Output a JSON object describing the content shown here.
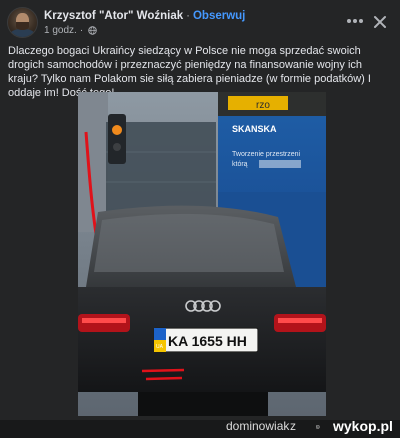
{
  "post": {
    "author": "Krzysztof \"Ator\" Woźniak",
    "separator": "·",
    "follow_label": "Obserwuj",
    "time": "1 godz.",
    "text": "Dlaczego bogaci Ukraińcy siedzący w Polsce nie moga sprzedać swoich drogich samochodów i przeznaczyć pieniędzy na finansowanie wojny ich kraju? Tylko nam Polakom sie siłą zabiera pieniadze (w formie podatków) I oddaje im! Dość tego!"
  },
  "photo": {
    "plate_country": "UA",
    "plate_number": "KA 1655 HH",
    "bus_brand": "SKANSKA",
    "bus_slogan_line1": "Tworzenie przestrzeni",
    "bus_slogan_line2": "którą ",
    "bus_top_text": "rzo"
  },
  "watermark": {
    "username": "dominowiak",
    "z": "z",
    "site": "wykop.pl"
  },
  "colors": {
    "link_blue": "#4599ff",
    "background": "#242526",
    "arrow_red": "#e0121a"
  },
  "icons": [
    "globe-icon",
    "more-icon",
    "close-icon",
    "wykop-logo-icon"
  ]
}
